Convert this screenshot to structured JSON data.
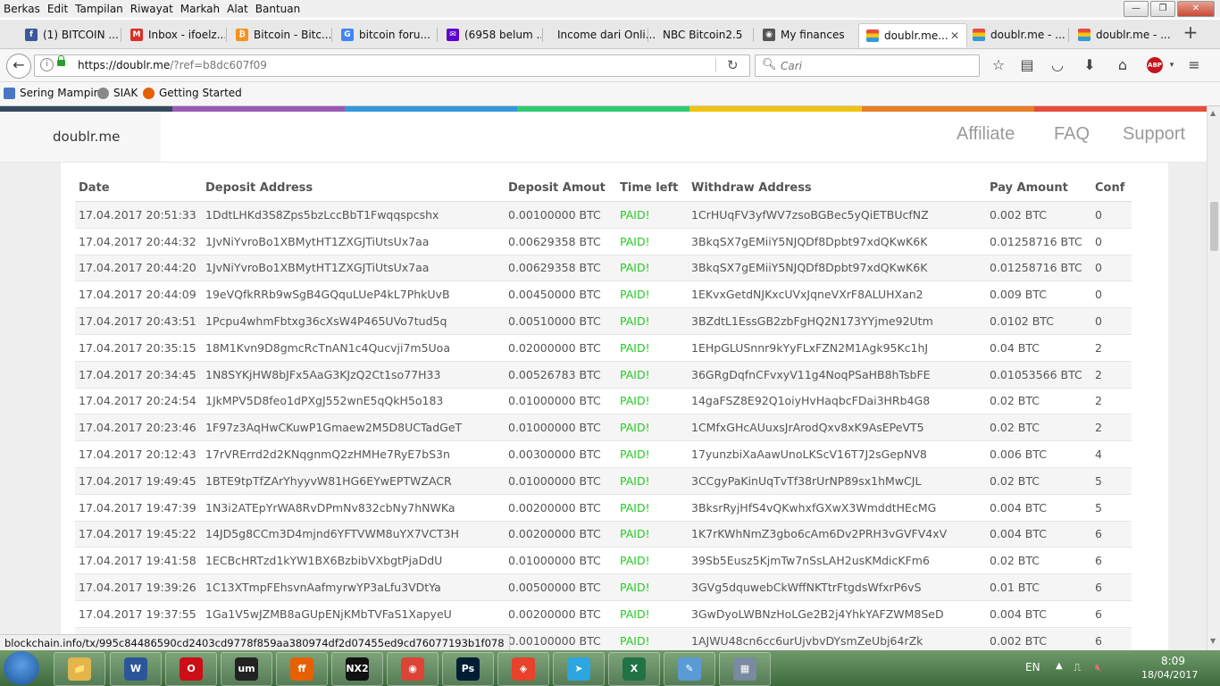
{
  "menu": [
    "Berkas",
    "Edit",
    "Tampilan",
    "Riwayat",
    "Markah",
    "Alat",
    "Bantuan"
  ],
  "window_controls": {
    "minimize": "—",
    "maximize": "❐",
    "close": "✕"
  },
  "tabs": [
    {
      "label": "(1) BITCOIN ...",
      "icon": "facebook-icon",
      "color": "#3b5998",
      "glyph": "f"
    },
    {
      "label": "Inbox - ifoelz...",
      "icon": "gmail-icon",
      "color": "#d93025",
      "glyph": "M"
    },
    {
      "label": "Bitcoin - Bitc...",
      "icon": "bitcoin-icon",
      "color": "#f7931a",
      "glyph": "₿"
    },
    {
      "label": "bitcoin foru...",
      "icon": "google-icon",
      "color": "#4285f4",
      "glyph": "G"
    },
    {
      "label": "(6958 belum ...",
      "icon": "yahoo-mail-icon",
      "color": "#5f01d1",
      "glyph": "✉"
    },
    {
      "label": "Income dari Onli...",
      "icon": "",
      "color": "",
      "glyph": ""
    },
    {
      "label": "NBC Bitcoin2.5",
      "icon": "",
      "color": "",
      "glyph": ""
    },
    {
      "label": "My finances",
      "icon": "globe-icon",
      "color": "#555555",
      "glyph": "◉"
    },
    {
      "label": "doublr.me...",
      "icon": "doublr-icon",
      "color": "#4caf50",
      "glyph": ""
    },
    {
      "label": "doublr.me - ...",
      "icon": "doublr-icon",
      "color": "#4caf50",
      "glyph": ""
    },
    {
      "label": "doublr.me - ...",
      "icon": "doublr-icon",
      "color": "#4caf50",
      "glyph": ""
    }
  ],
  "new_tab": "+",
  "address": {
    "host": "https://doublr.me",
    "rest": "/?ref=b8dc607f09"
  },
  "search": {
    "placeholder": "Cari"
  },
  "bookmarks": [
    {
      "label": "Sering Mampir",
      "icon": "bookmark-folder-icon",
      "color": "#4a76c8"
    },
    {
      "label": "SIAK",
      "icon": "globe-icon",
      "color": "#888888"
    },
    {
      "label": "Getting Started",
      "icon": "firefox-icon",
      "color": "#e66000"
    }
  ],
  "strip_colors": [
    "#34495e",
    "#9b59b6",
    "#3498db",
    "#2ecc71",
    "#f1c40f",
    "#e67e22",
    "#e74c3c"
  ],
  "site": {
    "brand": "doublr.me",
    "nav": [
      "Affiliate",
      "FAQ",
      "Support"
    ]
  },
  "table": {
    "headers": [
      "Date",
      "Deposit Address",
      "Deposit Amout",
      "Time left",
      "Withdraw Address",
      "Pay Amount",
      "Conf"
    ],
    "rows": [
      [
        "17.04.2017 20:51:33",
        "1DdtLHKd3S8Zps5bzLccBbT1Fwqqspcshx",
        "0.00100000 BTC",
        "PAID!",
        "1CrHUqFV3yfWV7zsoBGBec5yQiETBUcfNZ",
        "0.002 BTC",
        "0"
      ],
      [
        "17.04.2017 20:44:32",
        "1JvNiYvroBo1XBMytHT1ZXGJTiUtsUx7aa",
        "0.00629358 BTC",
        "PAID!",
        "3BkqSX7gEMiiY5NJQDf8Dpbt97xdQKwK6K",
        "0.01258716 BTC",
        "0"
      ],
      [
        "17.04.2017 20:44:20",
        "1JvNiYvroBo1XBMytHT1ZXGJTiUtsUx7aa",
        "0.00629358 BTC",
        "PAID!",
        "3BkqSX7gEMiiY5NJQDf8Dpbt97xdQKwK6K",
        "0.01258716 BTC",
        "0"
      ],
      [
        "17.04.2017 20:44:09",
        "19eVQfkRRb9wSgB4GQquLUeP4kL7PhkUvB",
        "0.00450000 BTC",
        "PAID!",
        "1EKvxGetdNJKxcUVxJqneVXrF8ALUHXan2",
        "0.009 BTC",
        "0"
      ],
      [
        "17.04.2017 20:43:51",
        "1Pcpu4whmFbtxg36cXsW4P465UVo7tud5q",
        "0.00510000 BTC",
        "PAID!",
        "3BZdtL1EssGB2zbFgHQ2N173YYjme92Utm",
        "0.0102 BTC",
        "0"
      ],
      [
        "17.04.2017 20:35:15",
        "18M1Kvn9D8gmcRcTnAN1c4Qucvji7m5Uoa",
        "0.02000000 BTC",
        "PAID!",
        "1EHpGLUSnnr9kYyFLxFZN2M1Agk95Kc1hJ",
        "0.04 BTC",
        "2"
      ],
      [
        "17.04.2017 20:34:45",
        "1N8SYKjHW8bJFx5AaG3KJzQ2Ct1so77H33",
        "0.00526783 BTC",
        "PAID!",
        "36GRgDqfnCFvxyV11g4NoqPSaHB8hTsbFE",
        "0.01053566 BTC",
        "2"
      ],
      [
        "17.04.2017 20:24:54",
        "1JkMPV5D8feo1dPXgJ552wnE5qQkH5o183",
        "0.01000000 BTC",
        "PAID!",
        "14gaFSZ8E92Q1oiyHvHaqbcFDai3HRb4G8",
        "0.02 BTC",
        "2"
      ],
      [
        "17.04.2017 20:23:46",
        "1F97z3AqHwCKuwP1Gmaew2M5D8UCTadGeT",
        "0.01000000 BTC",
        "PAID!",
        "1CMfxGHcAUuxsJrArodQxv8xK9AsEPeVT5",
        "0.02 BTC",
        "2"
      ],
      [
        "17.04.2017 20:12:43",
        "17rVRErrd2d2KNqgnmQ2zHMHe7RyE7bS3n",
        "0.00300000 BTC",
        "PAID!",
        "17yunzbiXaAawUnoLKScV16T7J2sGepNV8",
        "0.006 BTC",
        "4"
      ],
      [
        "17.04.2017 19:49:45",
        "1BTE9tpTfZArYhyyvW81HG6EYwEPTWZACR",
        "0.01000000 BTC",
        "PAID!",
        "3CCgyPaKinUqTvTf38rUrNP89sx1hMwCJL",
        "0.02 BTC",
        "5"
      ],
      [
        "17.04.2017 19:47:39",
        "1N3i2ATEpYrWA8RvDPmNv832cbNy7hNWKa",
        "0.00200000 BTC",
        "PAID!",
        "3BksrRyjHfS4vQKwhxfGXwX3WmddtHEcMG",
        "0.004 BTC",
        "5"
      ],
      [
        "17.04.2017 19:45:22",
        "14JD5g8CCm3D4mjnd6YFTVWM8uYX7VCT3H",
        "0.00200000 BTC",
        "PAID!",
        "1K7rKWhNmZ3gbo6cAm6Dv2PRH3vGVFV4xV",
        "0.004 BTC",
        "6"
      ],
      [
        "17.04.2017 19:41:58",
        "1ECBcHRTzd1kYW1BX6BzbibVXbgtPjaDdU",
        "0.01000000 BTC",
        "PAID!",
        "39Sb5Eusz5KjmTw7nSsLAH2usKMdicKFm6",
        "0.02 BTC",
        "6"
      ],
      [
        "17.04.2017 19:39:26",
        "1C13XTmpFEhsvnAafmyrwYP3aLfu3VDtYa",
        "0.00500000 BTC",
        "PAID!",
        "3GVg5dquwebCkWffNKTtrFtgdsWfxrP6vS",
        "0.01 BTC",
        "6"
      ],
      [
        "17.04.2017 19:37:55",
        "1Ga1V5wJZMB8aGUpENjKMbTVFaS1XapyeU",
        "0.00200000 BTC",
        "PAID!",
        "3GwDyoLWBNzHoLGe2B2j4YhkYAFZWM8SeD",
        "0.004 BTC",
        "6"
      ],
      [
        "",
        "",
        "0.00100000 BTC",
        "PAID!",
        "1AJWU48cn6cc6urUjvbvDYsmZeUbj64rZk",
        "0.002 BTC",
        "6"
      ]
    ]
  },
  "status_url": "blockchain.info/tx/995c84486590cd2403cd9778f859aa380974df2d07455ed9cd76077193b1f078",
  "taskbar": {
    "apps": [
      {
        "name": "explorer-icon",
        "glyph": "📁",
        "color": "#e2b64a"
      },
      {
        "name": "word-icon",
        "glyph": "W",
        "color": "#2b579a"
      },
      {
        "name": "opera-icon",
        "glyph": "O",
        "color": "#cc0f16"
      },
      {
        "name": "um-icon",
        "glyph": "um",
        "color": "#222222"
      },
      {
        "name": "firefox-icon",
        "glyph": "ff",
        "color": "#e66000"
      },
      {
        "name": "nx2-icon",
        "glyph": "NX2",
        "color": "#111111"
      },
      {
        "name": "chrome-icon",
        "glyph": "◉",
        "color": "#db4437"
      },
      {
        "name": "photoshop-icon",
        "glyph": "Ps",
        "color": "#001d34"
      },
      {
        "name": "screen-recorder-icon",
        "glyph": "◈",
        "color": "#e8412c"
      },
      {
        "name": "telegram-icon",
        "glyph": "➤",
        "color": "#2ca5e0"
      },
      {
        "name": "excel-icon",
        "glyph": "X",
        "color": "#217346"
      },
      {
        "name": "notes-icon",
        "glyph": "✎",
        "color": "#5a9bd5"
      },
      {
        "name": "calculator-icon",
        "glyph": "▦",
        "color": "#7a8aa0"
      }
    ],
    "lang": "EN",
    "time": "8:09",
    "date": "18/04/2017"
  }
}
